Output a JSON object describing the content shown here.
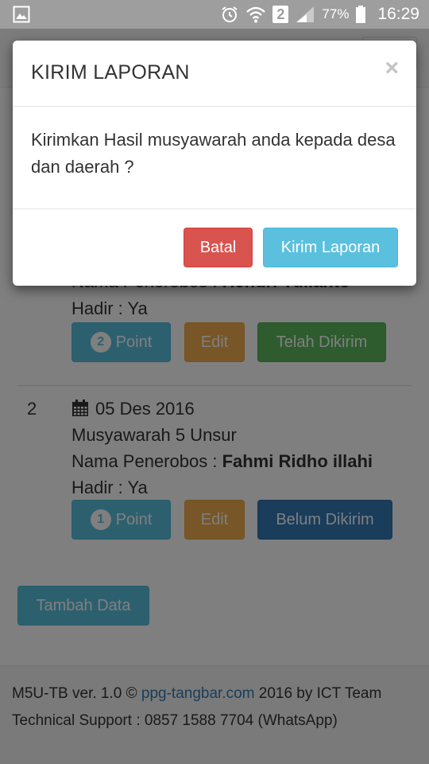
{
  "status_bar": {
    "sim_badge": "2",
    "battery_percent": "77%",
    "time": "16:29"
  },
  "records": [
    {
      "number": "",
      "date": "",
      "title": "",
      "intruder_label": "Nama Penerobos :",
      "intruder_name": "Hendri Yulianto",
      "attendance": "Hadir : Ya",
      "points_count": "2",
      "points_label": "Point",
      "edit_label": "Edit",
      "status_label": "Telah Dikirim",
      "status_color": "#5cb85c"
    },
    {
      "number": "2",
      "date": "05 Des 2016",
      "title": "Musyawarah 5 Unsur",
      "intruder_label": "Nama Penerobos :",
      "intruder_name": "Fahmi Ridho illahi",
      "attendance": "Hadir : Ya",
      "points_count": "1",
      "points_label": "Point",
      "edit_label": "Edit",
      "status_label": "Belum Dikirim",
      "status_color": "#337ab7"
    }
  ],
  "add_button_label": "Tambah Data",
  "footer": {
    "line1_prefix": "M5U-TB ver. 1.0 ©",
    "link": "ppg-tangbar.com",
    "line1_suffix": "2016 by ICT Team",
    "line2": "Technical Support : 0857 1588 7704 (WhatsApp)"
  },
  "modal": {
    "title": "KIRIM LAPORAN",
    "close_symbol": "×",
    "body": "Kirimkan Hasil musyawarah anda kepada desa dan daerah ?",
    "cancel_label": "Batal",
    "submit_label": "Kirim Laporan"
  },
  "colors": {
    "danger": "#d9534f",
    "info": "#5bc0de",
    "warning": "#f0ad4e",
    "success": "#5cb85c",
    "primary": "#337ab7"
  }
}
